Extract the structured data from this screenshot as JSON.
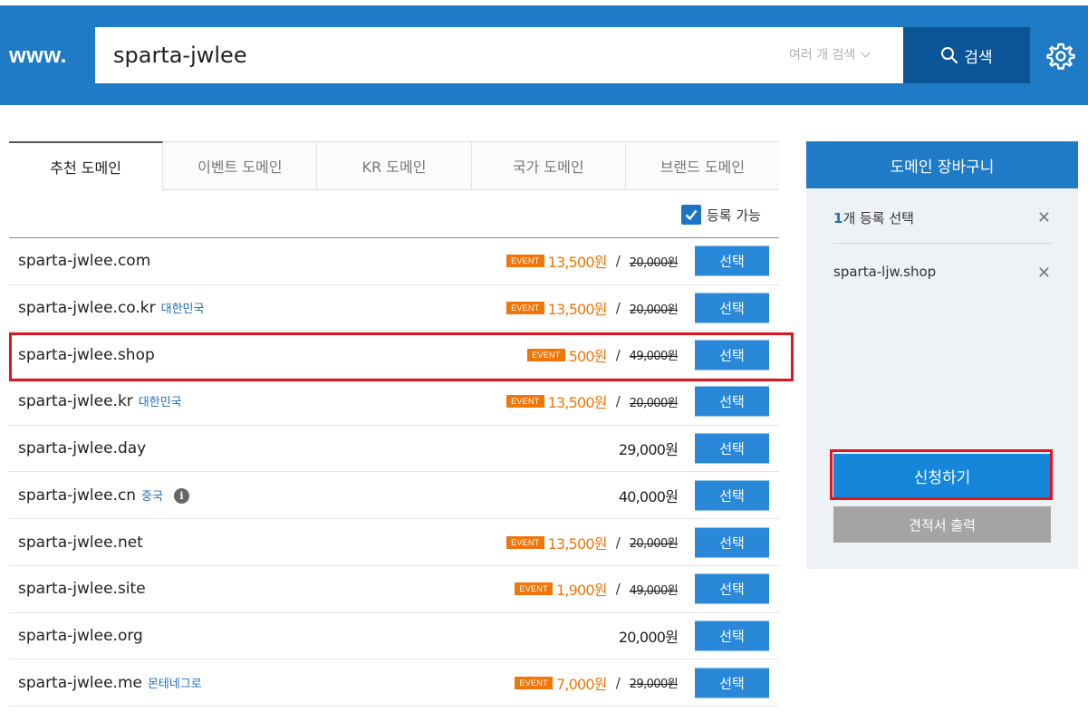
{
  "header": {
    "prefix": "www.",
    "search_value": "sparta-jwlee",
    "multi_search_label": "여러 개 검색",
    "search_button_label": "검색",
    "brand_color": "#1f7bc5"
  },
  "tabs": [
    {
      "label": "추천 도메인",
      "active": true
    },
    {
      "label": "이벤트 도메인",
      "active": false
    },
    {
      "label": "KR 도메인",
      "active": false
    },
    {
      "label": "국가 도메인",
      "active": false
    },
    {
      "label": "브랜드 도메인",
      "active": false
    }
  ],
  "filter": {
    "available_label": "등록 가능",
    "checked": true
  },
  "domains": [
    {
      "name": "sparta-jwlee.com",
      "region": "",
      "event": "EVENT",
      "price": "13,500원",
      "original": "20,000원",
      "button": "선택"
    },
    {
      "name": "sparta-jwlee.co.kr",
      "region": "대한민국",
      "event": "EVENT",
      "price": "13,500원",
      "original": "20,000원",
      "button": "선택"
    },
    {
      "name": "sparta-jwlee.shop",
      "region": "",
      "event": "EVENT",
      "price": "500원",
      "original": "49,000원",
      "button": "선택"
    },
    {
      "name": "sparta-jwlee.kr",
      "region": "대한민국",
      "event": "EVENT",
      "price": "13,500원",
      "original": "20,000원",
      "button": "선택"
    },
    {
      "name": "sparta-jwlee.day",
      "region": "",
      "event": "",
      "price": "29,000원",
      "original": "",
      "button": "선택"
    },
    {
      "name": "sparta-jwlee.cn",
      "region": "중국",
      "info": "i",
      "event": "",
      "price": "40,000원",
      "original": "",
      "button": "선택"
    },
    {
      "name": "sparta-jwlee.net",
      "region": "",
      "event": "EVENT",
      "price": "13,500원",
      "original": "20,000원",
      "button": "선택"
    },
    {
      "name": "sparta-jwlee.site",
      "region": "",
      "event": "EVENT",
      "price": "1,900원",
      "original": "49,000원",
      "button": "선택"
    },
    {
      "name": "sparta-jwlee.org",
      "region": "",
      "event": "",
      "price": "20,000원",
      "original": "",
      "button": "선택"
    },
    {
      "name": "sparta-jwlee.me",
      "region": "몬테네그로",
      "event": "EVENT",
      "price": "7,000원",
      "original": "29,000원",
      "button": "선택"
    }
  ],
  "cart": {
    "title": "도메인 장바구니",
    "count": "1",
    "count_suffix": "개 등록 선택",
    "items": [
      "sparta-ljw.shop"
    ],
    "remove_glyph": "✕",
    "apply_label": "신청하기",
    "quote_label": "견적서 출력"
  },
  "colors": {
    "event_orange": "#f0760a",
    "button_blue": "#2a88d8",
    "highlight_red": "#e0161e"
  }
}
